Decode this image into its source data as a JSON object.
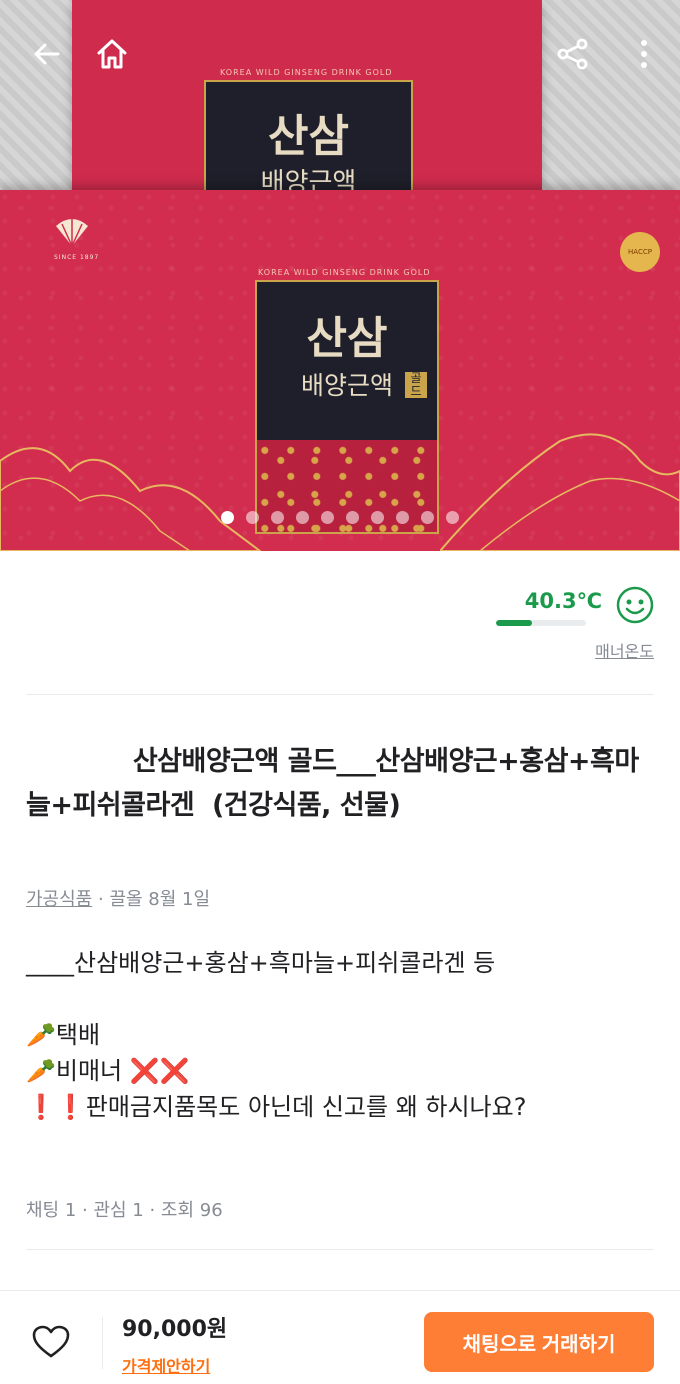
{
  "hero": {
    "box_subtitle": "KOREA WILD GINSENG DRINK GOLD",
    "box_title_line1": "산삼",
    "box_title_line2": "배양근액",
    "box_gold": "골드",
    "since": "SINCE 1897",
    "haccp": "HACCP",
    "image_count": 10,
    "active_index": 0
  },
  "header_icons": [
    "back-arrow-icon",
    "home-icon",
    "share-icon",
    "more-vertical-icon"
  ],
  "manner": {
    "temperature": "40.3℃",
    "temperature_fraction": 0.403,
    "label": "매너온도",
    "color": "#1a9a4a"
  },
  "post": {
    "title": "            산삼배양근액 골드___산삼배양근+홍삼+흑마늘+피쉬콜라겐  (건강식품, 선물)",
    "category": "가공식품",
    "time": "끌올 8월 1일",
    "desc": {
      "line1": "____산삼배양근+홍삼+흑마늘+피쉬콜라겐 등",
      "line2": "🥕택배",
      "line3": "🥕비매너 ❌❌",
      "line4": "❗❗판매금지품목도 아닌데 신고를 왜 하시나요?"
    },
    "stats": "채팅 1 · 관심 1 · 조회 96"
  },
  "bottom": {
    "price": "90,000원",
    "offer_label": "가격제안하기",
    "chat_button": "채팅으로 거래하기",
    "accent": "#ff7e36"
  }
}
